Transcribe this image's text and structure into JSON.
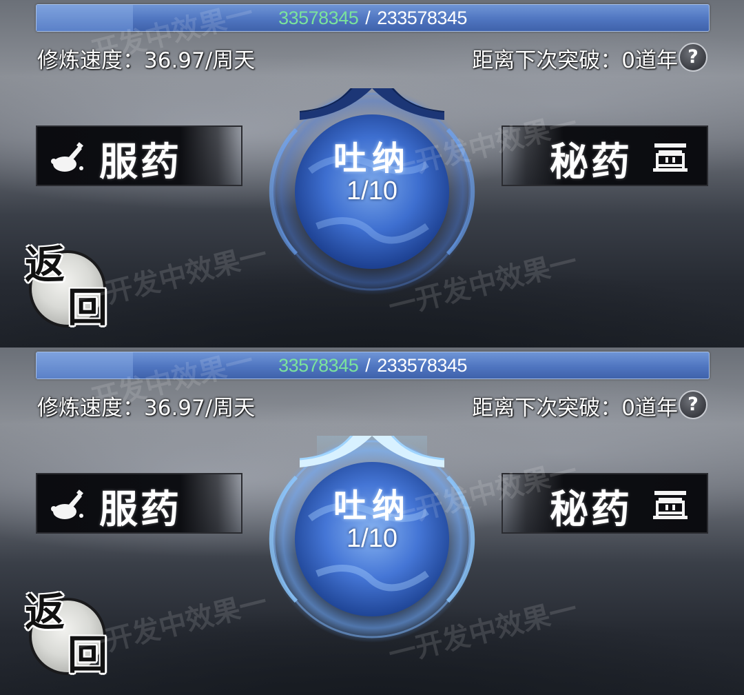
{
  "panels": [
    {
      "id": "top",
      "progress": {
        "current": "33578345",
        "separator": "/",
        "max": "233578345",
        "fraction": 0.1438
      },
      "stats": {
        "speed": "修炼速度：36.97/周天",
        "breakthrough": "距离下次突破：0道年"
      },
      "help": "?",
      "left_button": "服药",
      "right_button": "秘药",
      "orb": {
        "title": "吐纳",
        "count": "1/10",
        "state": "normal"
      },
      "back": {
        "char1": "返",
        "char2": "回"
      }
    },
    {
      "id": "bottom",
      "progress": {
        "current": "33578345",
        "separator": "/",
        "max": "233578345",
        "fraction": 0.1438
      },
      "stats": {
        "speed": "修炼速度：36.97/周天",
        "breakthrough": "距离下次突破：0道年"
      },
      "help": "?",
      "left_button": "服药",
      "right_button": "秘药",
      "orb": {
        "title": "吐纳",
        "count": "1/10",
        "state": "highlighted"
      },
      "back": {
        "char1": "返",
        "char2": "回"
      }
    }
  ],
  "watermark": "一开发中效果一",
  "colors": {
    "progress_current": "#7be39c",
    "orb_blue": "#3e6fd0",
    "glow": "#9fd4ff"
  },
  "icons": {
    "left": "gourd-pill-icon",
    "right": "cauldron-icon",
    "help": "help-icon"
  }
}
